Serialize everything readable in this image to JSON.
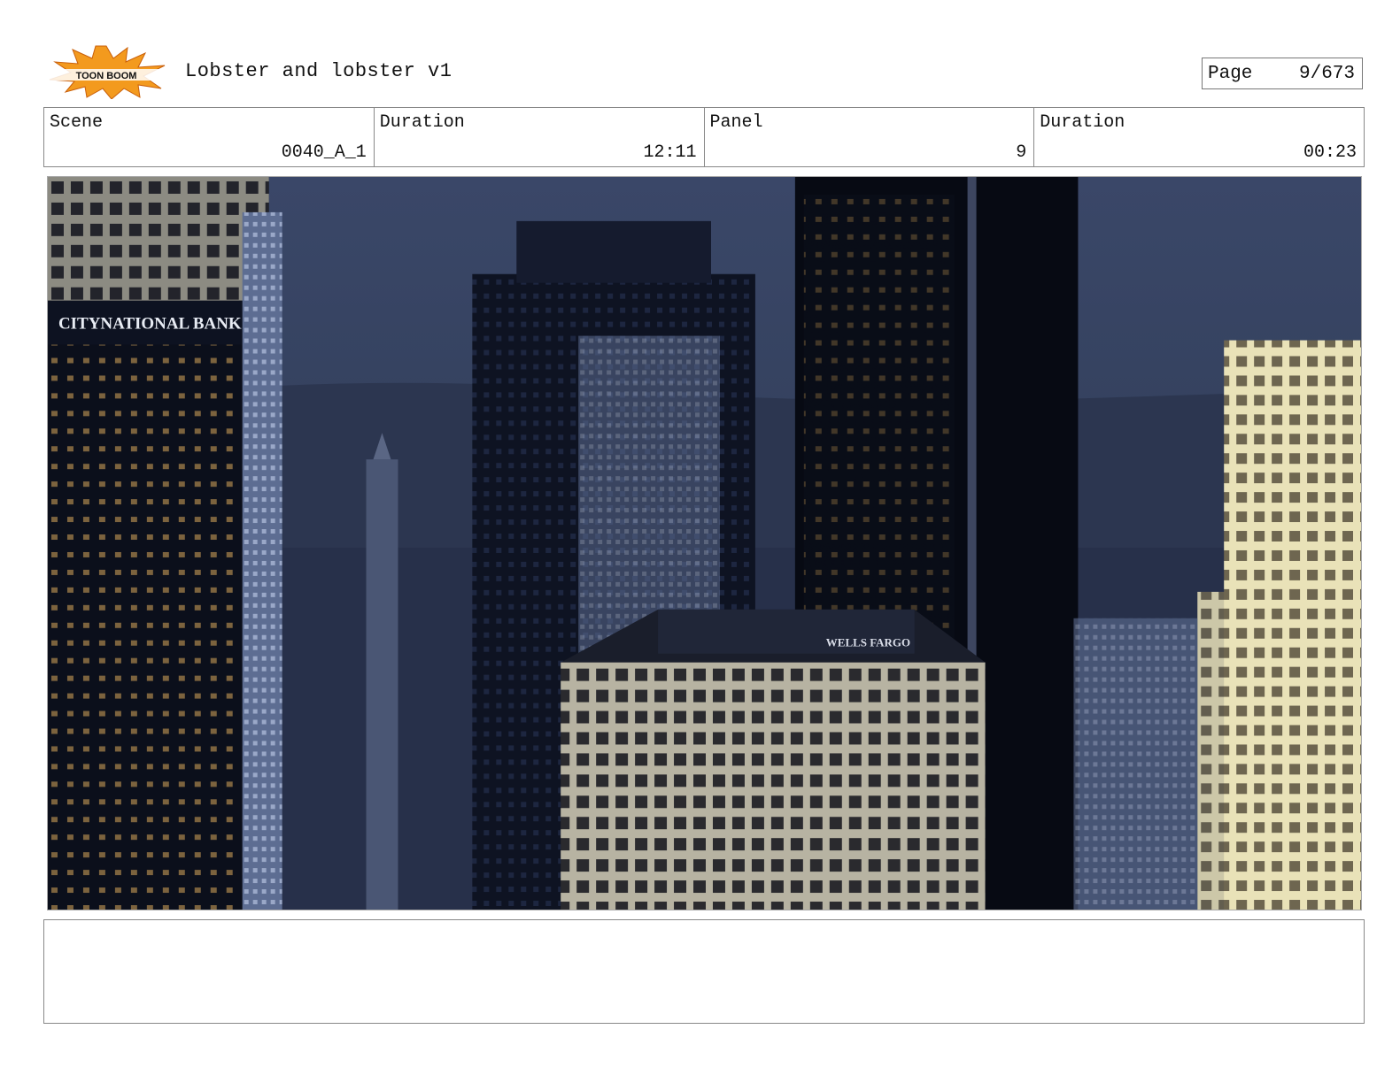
{
  "header": {
    "logo_text": "TOON BOOM",
    "title": "Lobster and lobster v1",
    "page_label": "Page",
    "page_value": "9/673"
  },
  "info": {
    "scene_label": "Scene",
    "scene_value": "0040_A_1",
    "scene_duration_label": "Duration",
    "scene_duration_value": "12:11",
    "panel_label": "Panel",
    "panel_value": "9",
    "panel_duration_label": "Duration",
    "panel_duration_value": "00:23"
  },
  "panel_image": {
    "signs": [
      "CITYNATIONAL BANK",
      "WELLS FARGO"
    ]
  },
  "notes": {
    "text": ""
  }
}
